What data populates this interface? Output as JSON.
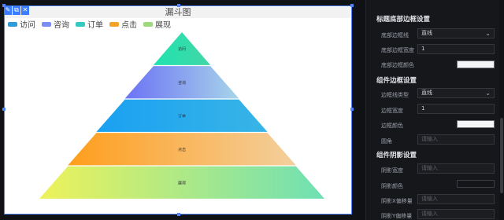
{
  "chart": {
    "title": "漏斗图",
    "legend": [
      {
        "label": "访问",
        "color": "#2f9bd8"
      },
      {
        "label": "咨询",
        "color": "#7b8cf2"
      },
      {
        "label": "订单",
        "color": "#35c9c0"
      },
      {
        "label": "点击",
        "color": "#f4a32a"
      },
      {
        "label": "展现",
        "color": "#9fd97d"
      }
    ]
  },
  "chart_data": {
    "type": "funnel",
    "stages": [
      {
        "label": "访问",
        "value": 20,
        "colors": [
          "#20e3b0",
          "#43d6a7"
        ]
      },
      {
        "label": "咨询",
        "value": 40,
        "colors": [
          "#6b73f5",
          "#a8d4e9"
        ]
      },
      {
        "label": "订单",
        "value": 60,
        "colors": [
          "#1aa0f2",
          "#38b5e6"
        ]
      },
      {
        "label": "点击",
        "value": 80,
        "colors": [
          "#ff9e1c",
          "#f3cf9d"
        ]
      },
      {
        "label": "展现",
        "value": 100,
        "colors": [
          "#eef25a",
          "#6ee0b4"
        ]
      }
    ]
  },
  "panel": {
    "sections": [
      {
        "title": "标题底部边框设置"
      },
      {
        "title": "组件边框设置"
      },
      {
        "title": "组件阴影设置"
      }
    ],
    "rows": [
      {
        "label": "底部边框线",
        "value": "直线",
        "kind": "select"
      },
      {
        "label": "底部边框宽度",
        "value": "1",
        "kind": "input"
      },
      {
        "label": "底部边框颜色",
        "value": "",
        "kind": "color"
      },
      {
        "label": "边框线类型",
        "value": "直线",
        "kind": "select"
      },
      {
        "label": "边框宽度",
        "value": "1",
        "kind": "input"
      },
      {
        "label": "边框颜色",
        "value": "",
        "kind": "color"
      },
      {
        "label": "圆角",
        "placeholder": "请输入",
        "kind": "input"
      },
      {
        "label": "阴影宽度",
        "placeholder": "请输入",
        "kind": "input"
      },
      {
        "label": "阴影颜色",
        "value": "",
        "kind": "color-dark"
      },
      {
        "label": "阴影X偏移量",
        "placeholder": "请输入",
        "kind": "input"
      },
      {
        "label": "阴影Y偏移量",
        "placeholder": "请输入",
        "kind": "input"
      }
    ]
  }
}
